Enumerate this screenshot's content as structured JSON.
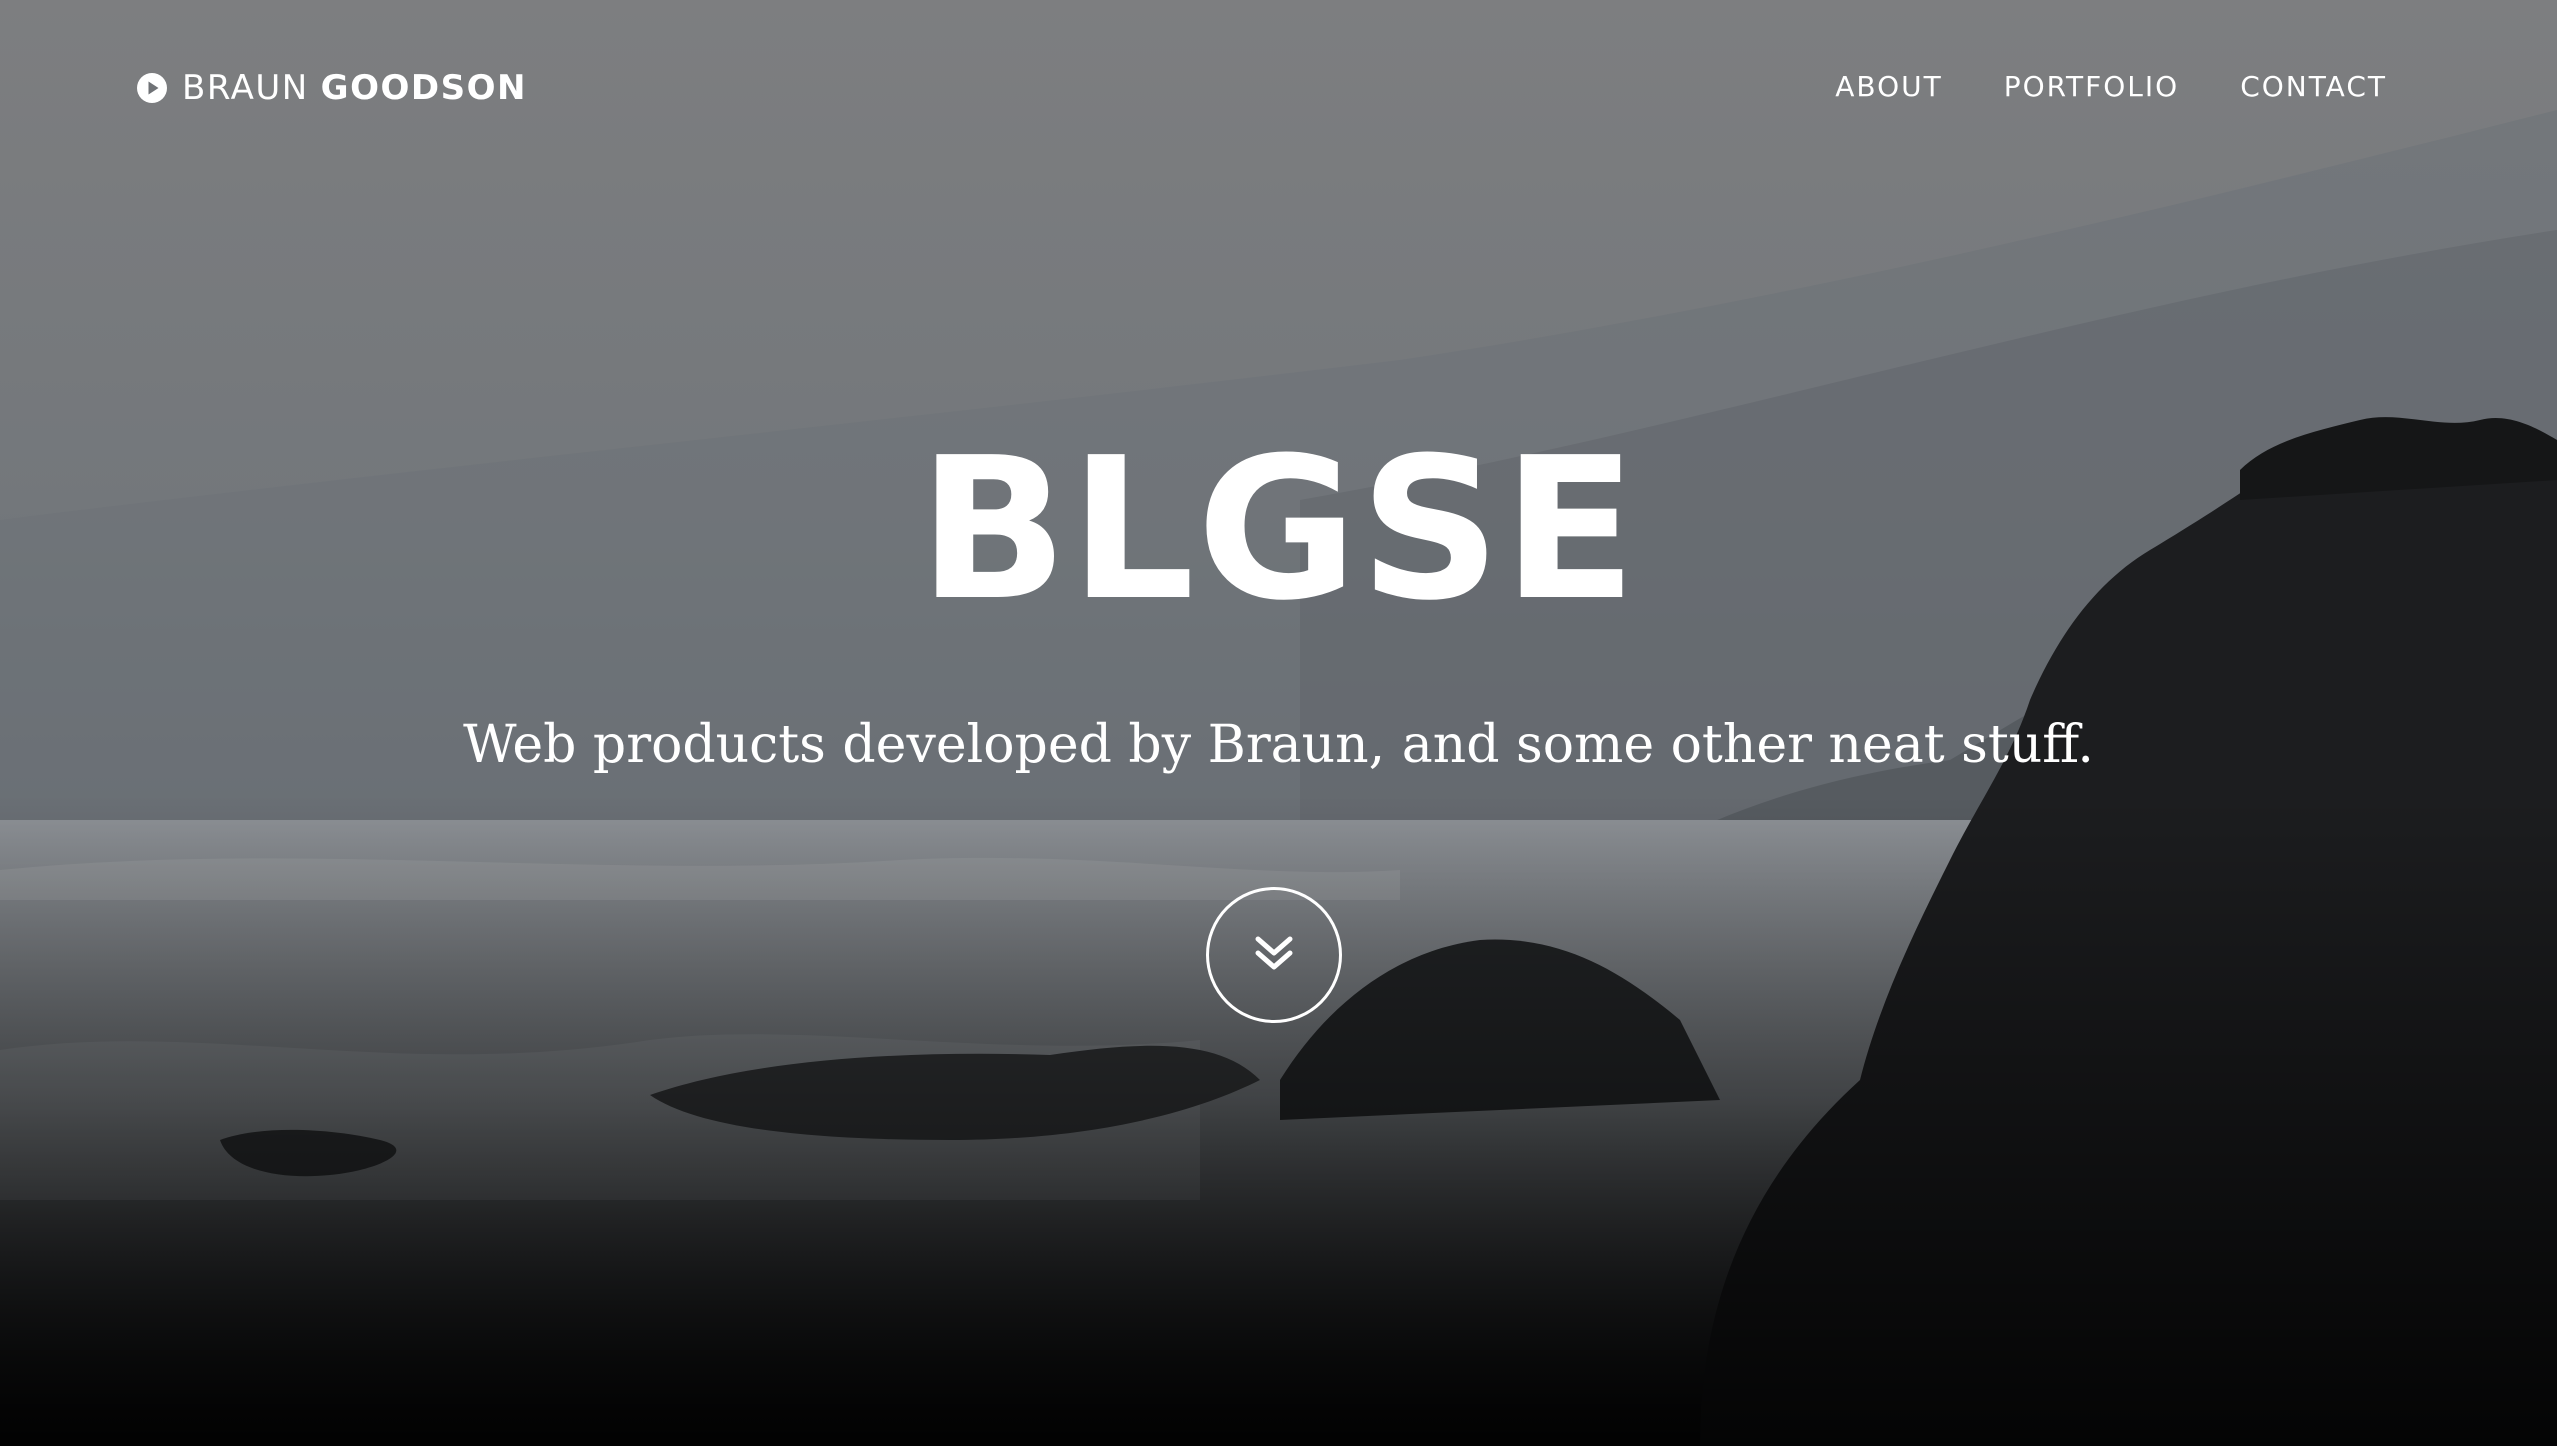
{
  "brand": {
    "first": "BRAUN",
    "last": "GOODSON",
    "icon": "play-circle-icon"
  },
  "nav": {
    "items": [
      {
        "label": "ABOUT"
      },
      {
        "label": "PORTFOLIO"
      },
      {
        "label": "CONTACT"
      }
    ]
  },
  "hero": {
    "title": "BLGSE",
    "tagline": "Web products developed by Braun, and some other neat stuff.",
    "scroll_icon": "double-chevron-down-icon"
  },
  "colors": {
    "text": "#ffffff",
    "overlay_top": "#7a7b7d",
    "overlay_bottom": "#0c0c0d"
  }
}
